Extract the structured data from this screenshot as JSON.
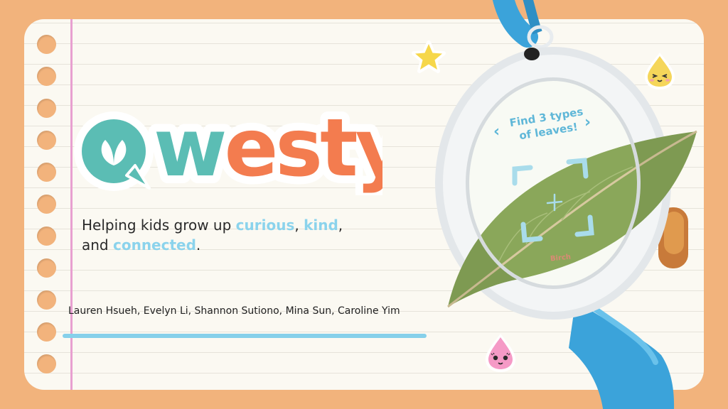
{
  "brand": {
    "name": "Qwesty",
    "colors": {
      "teal": "#5BBDB4",
      "orange": "#F37C4F",
      "accent_blue": "#8BD3EC",
      "background": "#F2B37C",
      "paper": "#FBF9F2"
    }
  },
  "tagline": {
    "part1": "Helping kids grow up ",
    "word1": "curious",
    "sep1": ", ",
    "word2": "kind",
    "sep2": ",",
    "part2": "and ",
    "word3": "connected",
    "end": "."
  },
  "authors": "Lauren Hsueh, Evelyn Li, Shannon Sutiono, Mina Sun, Caroline Yim",
  "device": {
    "prompt": "Find 3 types of leaves!",
    "prev_arrow": "‹",
    "next_arrow": "›",
    "leaf_label": "Birch"
  },
  "icons": [
    "star-icon",
    "yellow-drop-mascot-icon",
    "pink-drop-mascot-icon",
    "crosshair-icon",
    "leaf-icon"
  ]
}
